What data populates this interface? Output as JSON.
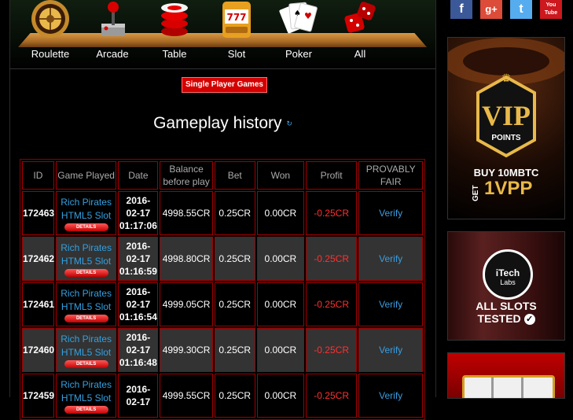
{
  "categories": [
    {
      "label": "Roulette",
      "icon": "roulette-icon"
    },
    {
      "label": "Arcade",
      "icon": "joystick-icon"
    },
    {
      "label": "Table",
      "icon": "chips-icon"
    },
    {
      "label": "Slot",
      "icon": "slot-machine-icon"
    },
    {
      "label": "Poker",
      "icon": "cards-icon"
    },
    {
      "label": "All",
      "icon": "dice-icon"
    }
  ],
  "single_player_button": "Single Player Games",
  "page_title": "Gameplay history",
  "refresh_glyph": "↻",
  "table": {
    "headers": [
      "ID",
      "Game Played",
      "Date",
      "Balance before play",
      "Bet",
      "Won",
      "Profit",
      "PROVABLY FAIR"
    ],
    "details_label": "DETAILS",
    "rows": [
      {
        "id": "172463",
        "game_line1": "Rich Pirates",
        "game_line2": "HTML5 Slot",
        "date1": "2016-",
        "date2": "02-17",
        "time": "01:17:06",
        "balance": "4998.55CR",
        "bet": "0.25CR",
        "won": "0.00CR",
        "profit": "-0.25CR",
        "verify": "Verify"
      },
      {
        "id": "172462",
        "game_line1": "Rich Pirates",
        "game_line2": "HTML5 Slot",
        "date1": "2016-",
        "date2": "02-17",
        "time": "01:16:59",
        "balance": "4998.80CR",
        "bet": "0.25CR",
        "won": "0.00CR",
        "profit": "-0.25CR",
        "verify": "Verify"
      },
      {
        "id": "172461",
        "game_line1": "Rich Pirates",
        "game_line2": "HTML5 Slot",
        "date1": "2016-",
        "date2": "02-17",
        "time": "01:16:54",
        "balance": "4999.05CR",
        "bet": "0.25CR",
        "won": "0.00CR",
        "profit": "-0.25CR",
        "verify": "Verify"
      },
      {
        "id": "172460",
        "game_line1": "Rich Pirates",
        "game_line2": "HTML5 Slot",
        "date1": "2016-",
        "date2": "02-17",
        "time": "01:16:48",
        "balance": "4999.30CR",
        "bet": "0.25CR",
        "won": "0.00CR",
        "profit": "-0.25CR",
        "verify": "Verify"
      },
      {
        "id": "172459",
        "game_line1": "Rich Pirates",
        "game_line2": "HTML5 Slot",
        "date1": "2016-",
        "date2": "02-17",
        "time": "",
        "balance": "4999.55CR",
        "bet": "0.25CR",
        "won": "0.00CR",
        "profit": "-0.25CR",
        "verify": "Verify"
      }
    ]
  },
  "social": [
    {
      "name": "facebook-icon",
      "glyph": "f",
      "color": "#3b5998"
    },
    {
      "name": "google-plus-icon",
      "glyph": "g+",
      "color": "#dd4b39"
    },
    {
      "name": "twitter-icon",
      "glyph": "t",
      "color": "#55acee"
    },
    {
      "name": "youtube-icon",
      "glyph": "You Tube",
      "color": "#cc181e"
    }
  ],
  "ads": {
    "vip": {
      "line1": "VIP",
      "line2": "POINTS",
      "line3": "BUY 10MBTC",
      "line4": "GET",
      "line5": "1VPP"
    },
    "itech": {
      "brand1": "iTech",
      "brand2": "Labs",
      "line1": "ALL SLOTS",
      "line2": "TESTED"
    }
  },
  "colors": {
    "accent_red": "#d40000",
    "link_blue": "#33a0e0",
    "profit_red": "#ff3030",
    "table_border": "#a00000",
    "gold": "#e8b94a"
  }
}
